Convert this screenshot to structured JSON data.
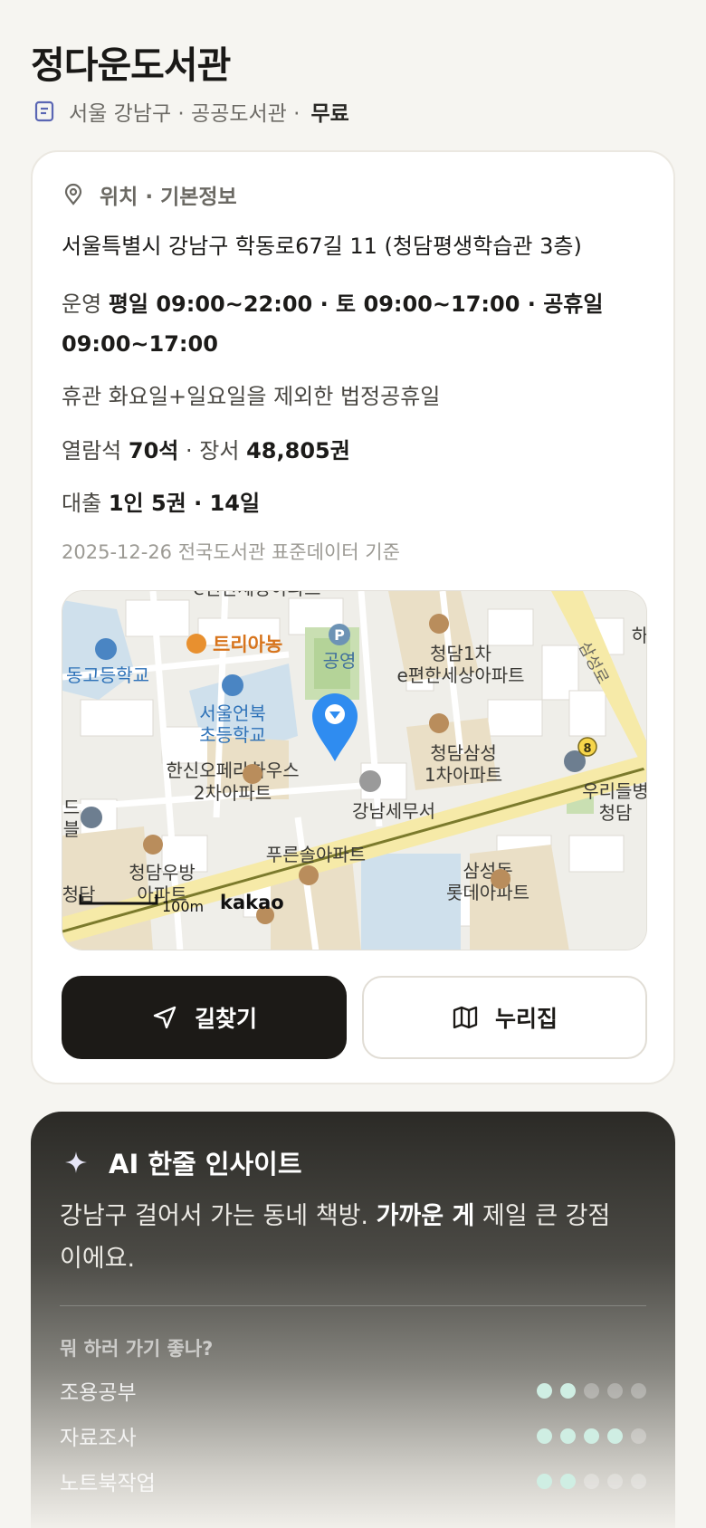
{
  "header": {
    "title": "정다운도서관",
    "meta": "서울 강남구 · 공공도서관 ·",
    "fee": "무료",
    "doc_icon": "document-icon"
  },
  "info": {
    "section_title": "위치 · 기본정보",
    "location_icon": "map-pin-icon",
    "address": "서울특별시 강남구 학동로67길 11 (청담평생학습관 3층)",
    "hours_label": "운영",
    "hours_value": "평일 09:00~22:00 · 토 09:00~17:00 · 공휴일 09:00~17:00",
    "closed": "휴관 화요일+일요일을 제외한 법정공휴일",
    "seats_label": "열람석",
    "seats_value": "70석",
    "sep": "·",
    "books_label": "장서",
    "books_value": "48,805권",
    "loan_label": "대출",
    "loan_value": "1인 5권 · 14일",
    "source": "2025-12-26 전국도서관 표준데이터 기준"
  },
  "map": {
    "labels": {
      "top_apt": "e편한세상아파트",
      "cafe": "트리아농",
      "park": "공영",
      "p": "P",
      "cheongdam1": "청담1차",
      "cheongdam1b": "e편한세상아파트",
      "samseongro": "삼성로",
      "ha": "하",
      "highschool": "동고등학교",
      "elem1": "서울언북",
      "elem2": "초등학교",
      "hanshin1": "한신오페라하우스",
      "hanshin2": "2차아파트",
      "cheongdamsamsung1": "청담삼성",
      "cheongdamsamsung2": "1차아파트",
      "hospital1": "우리들병",
      "hospital2": "청담",
      "bus8": "8",
      "tax": "강남세무서",
      "de": "드",
      "bul": "블",
      "pureunsol": "푸른솔아파트",
      "woobang1": "청담우방",
      "woobang2": "아파트",
      "cheongdam_left": "청담",
      "samsungdong1": "삼성동",
      "samsungdong2": "롯데아파트",
      "scale": "100m",
      "brand": "kakao"
    }
  },
  "actions": {
    "directions": "길찾기",
    "directions_icon": "navigation-arrow-icon",
    "nurizip": "누리집",
    "nurizip_icon": "map-icon"
  },
  "ai": {
    "title": "AI 한줄 인사이트",
    "icon": "sparkle-icon",
    "text_a": "강남구 걸어서 가는 동네 책방. ",
    "text_b": "가까운 게",
    "text_c": " 제일 큰 강점이에요.",
    "question": "뭐 하러 가기 좋나?",
    "ratings": [
      {
        "label": "조용공부",
        "score": 2,
        "max": 5
      },
      {
        "label": "자료조사",
        "score": 4,
        "max": 5
      },
      {
        "label": "노트북작업",
        "score": 2,
        "max": 5
      }
    ]
  },
  "colors": {
    "accent_dark": "#1c1a17",
    "pin": "#2f8cf0",
    "rating_on": "#cfeee3"
  }
}
